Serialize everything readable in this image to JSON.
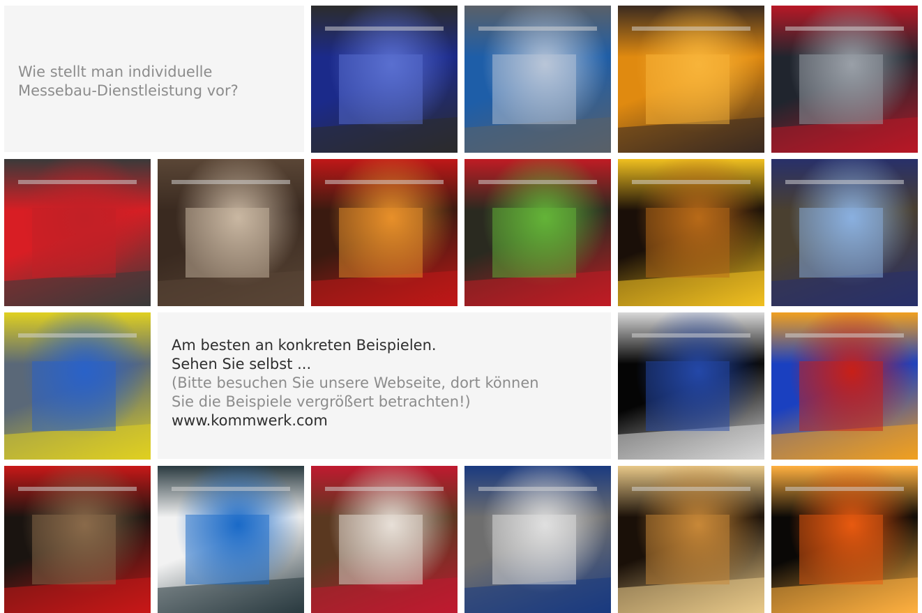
{
  "intro": {
    "question_line1": "Wie stellt man individuelle",
    "question_line2": "Messebau-Dienstleistung vor?"
  },
  "middle": {
    "line1": "Am besten an konkreten Beispielen.",
    "line2": "Sehen Sie selbst ...",
    "note_line1": "(Bitte besuchen Sie unsere Webseite, dort können",
    "note_line2": "Sie die Beispiele vergrößert betrachten!)",
    "website": "www.kommwerk.com"
  },
  "tiles": [
    {
      "name": "booth-photo-1",
      "colors": [
        "#1b2a8a",
        "#5a6fd0",
        "#2c2c2c"
      ]
    },
    {
      "name": "booth-photo-2",
      "colors": [
        "#1e5ea8",
        "#b9c6d8",
        "#5a6068"
      ]
    },
    {
      "name": "booth-photo-3",
      "colors": [
        "#e08a10",
        "#f7b43a",
        "#3a2a20"
      ]
    },
    {
      "name": "booth-photo-4",
      "colors": [
        "#20252e",
        "#9aa0a8",
        "#b81826"
      ]
    },
    {
      "name": "booth-photo-5",
      "colors": [
        "#d81e24",
        "#c22026",
        "#3a3a3a"
      ]
    },
    {
      "name": "booth-photo-6",
      "colors": [
        "#3a2a20",
        "#c9b7a2",
        "#5a4636"
      ]
    },
    {
      "name": "booth-photo-7",
      "colors": [
        "#3a1a10",
        "#e8902a",
        "#c01818"
      ]
    },
    {
      "name": "booth-photo-8",
      "colors": [
        "#2a2a20",
        "#64b438",
        "#c01c24"
      ]
    },
    {
      "name": "booth-photo-9",
      "colors": [
        "#1a0f08",
        "#b86a18",
        "#f0c020"
      ]
    },
    {
      "name": "booth-photo-10",
      "colors": [
        "#4a4030",
        "#8ab0e0",
        "#28306a"
      ]
    },
    {
      "name": "booth-photo-11",
      "colors": [
        "#5a6878",
        "#2a62c8",
        "#e0d020"
      ]
    },
    {
      "name": "booth-render-12",
      "colors": [
        "#050505",
        "#2448a8",
        "#d8d8d8"
      ]
    },
    {
      "name": "booth-photo-13",
      "colors": [
        "#1a40c0",
        "#c82018",
        "#f0a020"
      ]
    },
    {
      "name": "booth-photo-14",
      "colors": [
        "#1a1410",
        "#8a6a4a",
        "#c81818"
      ]
    },
    {
      "name": "booth-render-15",
      "colors": [
        "#f2f2f2",
        "#1a6ac8",
        "#2a3a40"
      ]
    },
    {
      "name": "booth-photo-16",
      "colors": [
        "#5a3820",
        "#e8e0d8",
        "#c01a30"
      ]
    },
    {
      "name": "booth-render-17",
      "colors": [
        "#6e6e6e",
        "#e0e0e0",
        "#1a3a80"
      ]
    },
    {
      "name": "booth-photo-18",
      "colors": [
        "#1a1008",
        "#c88838",
        "#e8c888"
      ]
    },
    {
      "name": "booth-photo-19",
      "colors": [
        "#0a0806",
        "#e85a10",
        "#ffb040"
      ]
    }
  ]
}
